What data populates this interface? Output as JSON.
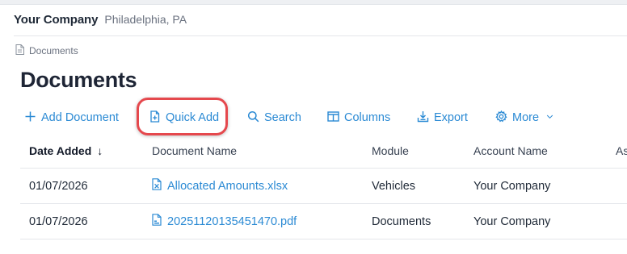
{
  "header": {
    "company_name": "Your Company",
    "company_location": "Philadelphia, PA"
  },
  "breadcrumb": {
    "label": "Documents"
  },
  "page": {
    "title": "Documents"
  },
  "toolbar": {
    "add_document": "Add Document",
    "quick_add": "Quick Add",
    "search": "Search",
    "columns": "Columns",
    "export": "Export",
    "more": "More"
  },
  "table": {
    "columns": [
      "Date Added",
      "Document Name",
      "Module",
      "Account Name",
      "As"
    ],
    "sort_indicator": "↓",
    "rows": [
      {
        "date_added": "01/07/2026",
        "document_name": "Allocated Amounts.xlsx",
        "document_icon": "spreadsheet-file-icon",
        "module": "Vehicles",
        "account_name": "Your Company"
      },
      {
        "date_added": "01/07/2026",
        "document_name": "20251120135451470.pdf",
        "document_icon": "pdf-file-icon",
        "module": "Documents",
        "account_name": "Your Company"
      }
    ]
  },
  "colors": {
    "link": "#2b8ad4",
    "highlight": "#e5484d",
    "title": "#1e2535"
  }
}
